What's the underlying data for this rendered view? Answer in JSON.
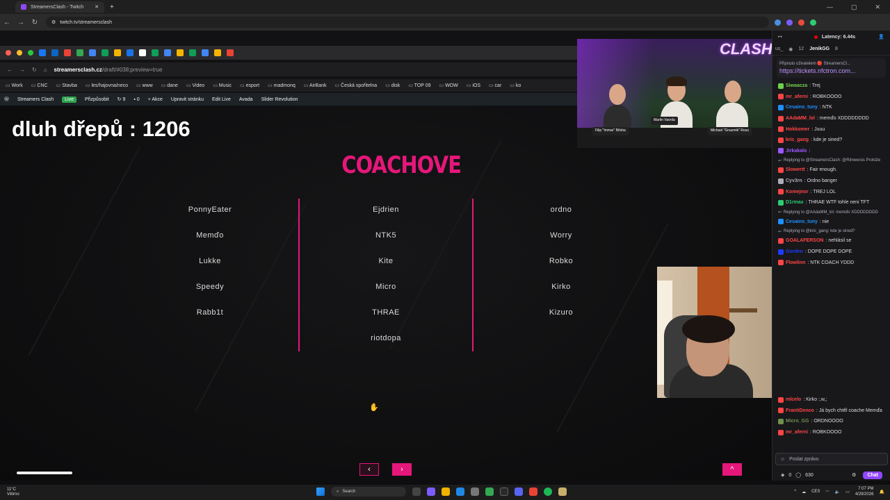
{
  "outer_browser": {
    "tab_title": "StreamersClash - Twitch",
    "url": "twitch.tv/streamersclash"
  },
  "inner_browser": {
    "url_host": "streamersclash.cz",
    "url_path": "/draft/#038;preview=true",
    "bookmarks": [
      "Work",
      "CNC",
      "Stavba",
      "les/hajovna/neco",
      "www",
      "dane",
      "Video",
      "Music",
      "esport",
      "madmonq",
      "AirBank",
      "Česká spořitelna",
      "disk",
      "TOP 09",
      "WOW",
      "iOS",
      "car",
      "ko"
    ],
    "wp_bar": {
      "site": "Streamers Clash",
      "live": "Live",
      "customize": "Přizpůsobit",
      "updates": "9",
      "comments": "0",
      "new": "Akce",
      "edit_page": "Upravit stránku",
      "edit_live": "Edit Live",
      "avada": "Avada",
      "slider": "Slider Revolution"
    }
  },
  "overlay": {
    "counter": "dluh dřepů : 1206"
  },
  "site": {
    "title": "COACHOVE",
    "columns": [
      [
        "PonnyEater",
        "Memďo",
        "Lukke",
        "Speedy",
        "Rabb1t"
      ],
      [
        "Ejdrien",
        "NTK5",
        "Kite",
        "Micro",
        "THRAE",
        "riotdopa"
      ],
      [
        "ordno",
        "Worry",
        "Robko",
        "Kirko",
        "Kizuro"
      ]
    ],
    "prev": "‹",
    "next": "›",
    "top": "^"
  },
  "stage_cam": {
    "logo": "CLASH",
    "names": [
      "Filip \"Immar\" Bíloha",
      "Martin Vavrda",
      "Michael \"Gnazmik\" Rous"
    ]
  },
  "chat": {
    "latency": "Latency: 6.44s",
    "viewers_short": "us_",
    "viewer_count": "12",
    "channel": "JenikGG",
    "subs": "8",
    "pinned_by": "Připnuto uživatelem 🔴 StreamersCl...",
    "pinned_link": "https://tickets.nfctron.com...",
    "messages": [
      {
        "user": "Siwaacza",
        "text": ": Trej",
        "color": "#6fcf4b",
        "reply": false
      },
      {
        "user": "mr_aferni",
        "text": ": ROBKOOOO",
        "color": "#ff4444",
        "reply": false
      },
      {
        "user": "Cesaino_tuny",
        "text": ": NTK",
        "color": "#1e90ff",
        "reply": false
      },
      {
        "user": "AAdaMM_lol",
        "text": ": memďo XDDDDDDDD",
        "color": "#ff4545",
        "reply": false
      },
      {
        "user": "Hokkomer",
        "text": ": Juuu",
        "color": "#ff4545",
        "reply": false
      },
      {
        "user": "kric_gang",
        "text": ": kde je sined?",
        "color": "#ff4545",
        "reply": false
      },
      {
        "user": "Jirkakalo",
        "text": ":",
        "color": "#9b59ff",
        "reply": false
      },
      {
        "user": "",
        "text": "Replying to @StreamersClash: @Rimweros Protože",
        "color": "#adadb8",
        "reply": true
      },
      {
        "user": "Slowertt",
        "text": ": Fair enough.",
        "color": "#ff4545",
        "reply": false
      },
      {
        "user": "Cyv3rn",
        "text": ": Ordno banger",
        "color": "#adadb8",
        "reply": false
      },
      {
        "user": "Komejnor",
        "text": ": TREJ LOL",
        "color": "#ff4545",
        "reply": false
      },
      {
        "user": "D1rmax",
        "text": ": THRAE WTF tohle neni TFT",
        "color": "#2ecc71",
        "reply": false
      },
      {
        "user": "",
        "text": "Replying to @AAdaMM_lol: memďo XDDDDDDDD",
        "color": "#adadb8",
        "reply": true
      },
      {
        "user": "Cesaino_tuny",
        "text": ": nie",
        "color": "#1e90ff",
        "reply": false
      },
      {
        "user": "",
        "text": "Replying to @kric_gang: kde je sined?",
        "color": "#adadb8",
        "reply": true
      },
      {
        "user": "GOALAFERSON",
        "text": ": nehlásil se",
        "color": "#ff4545",
        "reply": false
      },
      {
        "user": "Gorden",
        "text": ": DOPE DOPE DOPE",
        "color": "#1e3cff",
        "reply": false
      },
      {
        "user": "Flowlinn",
        "text": ": NTK COACH YDDD",
        "color": "#ff4545",
        "reply": false
      }
    ],
    "messages_bottom": [
      {
        "user": "mlcelo",
        "text": ": Kirko :,w,;",
        "color": "#ff4545"
      },
      {
        "user": "FrantiDenco",
        "text": ": Já bych chtěl coache Memďa",
        "color": "#ff4545"
      },
      {
        "user": "Micro_GG",
        "text": ": ORDNOOOO",
        "color": "#6f8f4b"
      },
      {
        "user": "mr_aferni",
        "text": ": ROBKOOOO",
        "color": "#ff4444"
      }
    ],
    "input_placeholder": "Poslat zprávu",
    "points": "0",
    "bits": "630",
    "chat_button": "Chat"
  },
  "taskbar": {
    "temp": "11°C",
    "weather": "Větrno",
    "search": "Search",
    "lang": "CES",
    "time": "7:07 PM",
    "date": "4/29/2026"
  }
}
